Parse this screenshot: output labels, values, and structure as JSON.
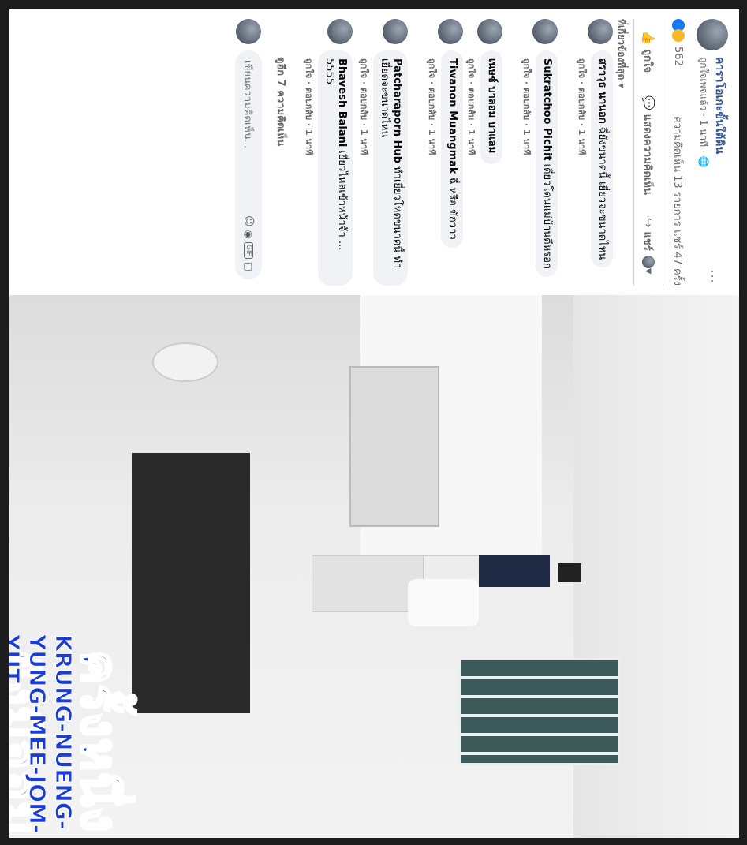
{
  "post": {
    "page_name": "คาราโอเกะขั้นใต้ดิน",
    "sub": "ถูกใจเพจแล้ว · 1 นาที ·",
    "reaction_count": "562",
    "comments_shares": "ความคิดเห็น 13 รายการ  แชร์ 47 ครั้ง"
  },
  "actions": {
    "like": "ถูกใจ",
    "comment": "แสดงความคิดเห็น",
    "share": "แชร์"
  },
  "sort_label": "ที่เกี่ยวข้องที่สุด",
  "comments": [
    {
      "name": "สราวุธ นานอก",
      "text": "ฉี่ยังขนาดนี้ เยี่ยวจะขนาดไหน",
      "meta": "ถูกใจ · ตอบกลับ · 1 นาที"
    },
    {
      "name": "Sukratchoo Pichit",
      "text": "เดี่ยวโดนแม่บ้านตีหรอก",
      "meta": "ถูกใจ · ตอบกลับ · 1 นาที"
    },
    {
      "name": "เนษซ์ บาลอม บาแลม",
      "text": "",
      "meta": "ถูกใจ · ตอบกลับ · 1 นาที"
    },
    {
      "name": "Tiwanon Muangmak",
      "text": "ฉี่ หรือ ขักวาว",
      "meta": "ถูกใจ · ตอบกลับ · 1 นาที"
    },
    {
      "name": "Patcharaporn Hub",
      "text": "ทำเยี่ยวโหดขนาดนี้ ทำเยี่ยดจะขนาดไหน",
      "meta": "ถูกใจ · ตอบกลับ · 1 นาที"
    },
    {
      "name": "Bhavesh Balani",
      "text": "เยี่ยวไหลเข้าหน้าจ้า ... 5555",
      "meta": "ถูกใจ · ตอบกลับ · 1 นาที"
    }
  ],
  "more_comments": "ดูอีก 7 ความคิดเห็น",
  "composer": {
    "placeholder": "เขียนความคิดเห็น...",
    "gif": "GIF"
  },
  "caption": {
    "thai": "ครั้งหนึ่งยังมีจอมยุทธ์",
    "english": "KRUNG-NUENG-YUNG-MEE-JOM-YUT"
  },
  "colors": {
    "caption": "#1a3dd6",
    "link": "#385898"
  }
}
